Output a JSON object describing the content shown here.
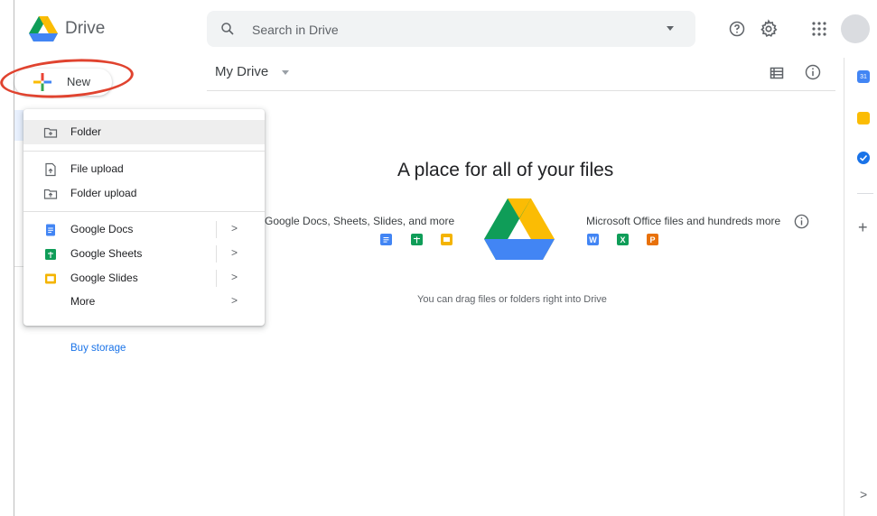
{
  "header": {
    "app_name": "Drive",
    "search_placeholder": "Search in Drive",
    "icons": [
      "drive-logo-icon",
      "search-icon",
      "help-icon",
      "settings-icon",
      "apps-grid-icon"
    ]
  },
  "toolbar": {
    "title": "My Drive"
  },
  "new_button": {
    "label": "New"
  },
  "new_menu": {
    "items": [
      {
        "label": "Folder",
        "icon": "folder-add-icon"
      },
      {
        "label": "File upload",
        "icon": "file-upload-icon"
      },
      {
        "label": "Folder upload",
        "icon": "folder-upload-icon"
      },
      {
        "label": "Google Docs",
        "icon": "google-docs-icon",
        "submenu": ">"
      },
      {
        "label": "Google Sheets",
        "icon": "google-sheets-icon",
        "submenu": ">"
      },
      {
        "label": "Google Slides",
        "icon": "google-slides-icon",
        "submenu": ">"
      },
      {
        "label": "More",
        "icon": "",
        "submenu": ">"
      }
    ]
  },
  "sidebar": {
    "buy_storage": "Buy storage"
  },
  "main": {
    "empty_title": "A place for all of your files",
    "docs_group_label": "Google Docs, Sheets, Slides, and more",
    "office_group_label": "Microsoft Office files and hundreds more",
    "office_badges": [
      "W",
      "X",
      "P"
    ],
    "drag_hint": "You can drag files or folders right into Drive"
  },
  "right_rail": {
    "calendar_label": "31",
    "add_label": "+",
    "expand_label": ">"
  },
  "colors": {
    "accent_blue": "#1a73e8",
    "docs_blue": "#4285f4",
    "sheets_green": "#0f9d58",
    "slides_yellow": "#f4b400",
    "annotation_red": "#e0432f"
  }
}
